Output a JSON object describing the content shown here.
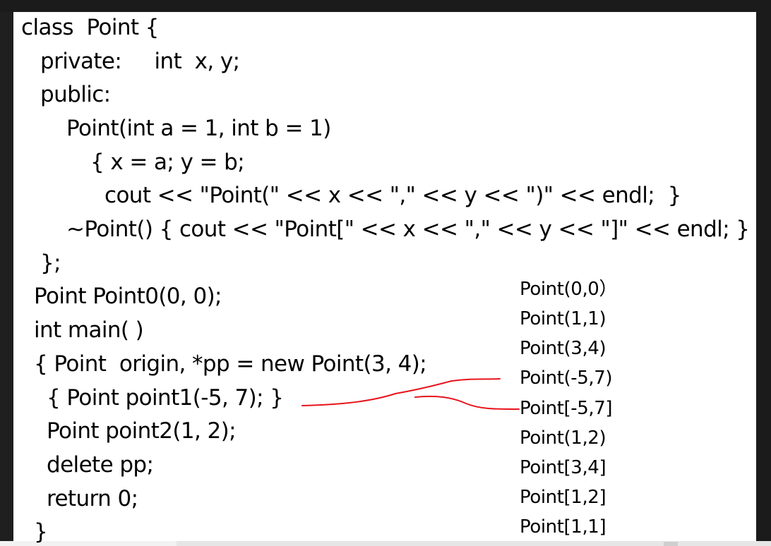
{
  "code_lines": [
    "class  Point {",
    "private:     int  x, y;",
    "public:",
    "Point(int a = 1, int b = 1)",
    "{ x = a; y = b;",
    "cout << \"Point(\" << x << \",\" << y << \")\" << endl;  }",
    "~Point() { cout << \"Point[\" << x << \",\" << y << \"]\" << endl; }",
    "};",
    "Point Point0(0, 0);",
    "int main( )",
    "{ Point  origin, *pp = new Point(3, 4);",
    "{ Point point1(-5, 7); }",
    "Point point2(1, 2);",
    "delete pp;",
    "return 0;",
    "}"
  ],
  "output_lines": [
    "Point(0,0）",
    "Point(1,1)",
    "Point(3,4)",
    "Point(-5,7)",
    "Point[-5,7]",
    "Point(1,2)",
    "Point[3,4]",
    "Point[1,2]",
    "Point[1,1]"
  ],
  "colors": {
    "annotation_ink": "#e8141c",
    "slide_background": "#ffffff",
    "frame_background": "#1b1b1b"
  }
}
